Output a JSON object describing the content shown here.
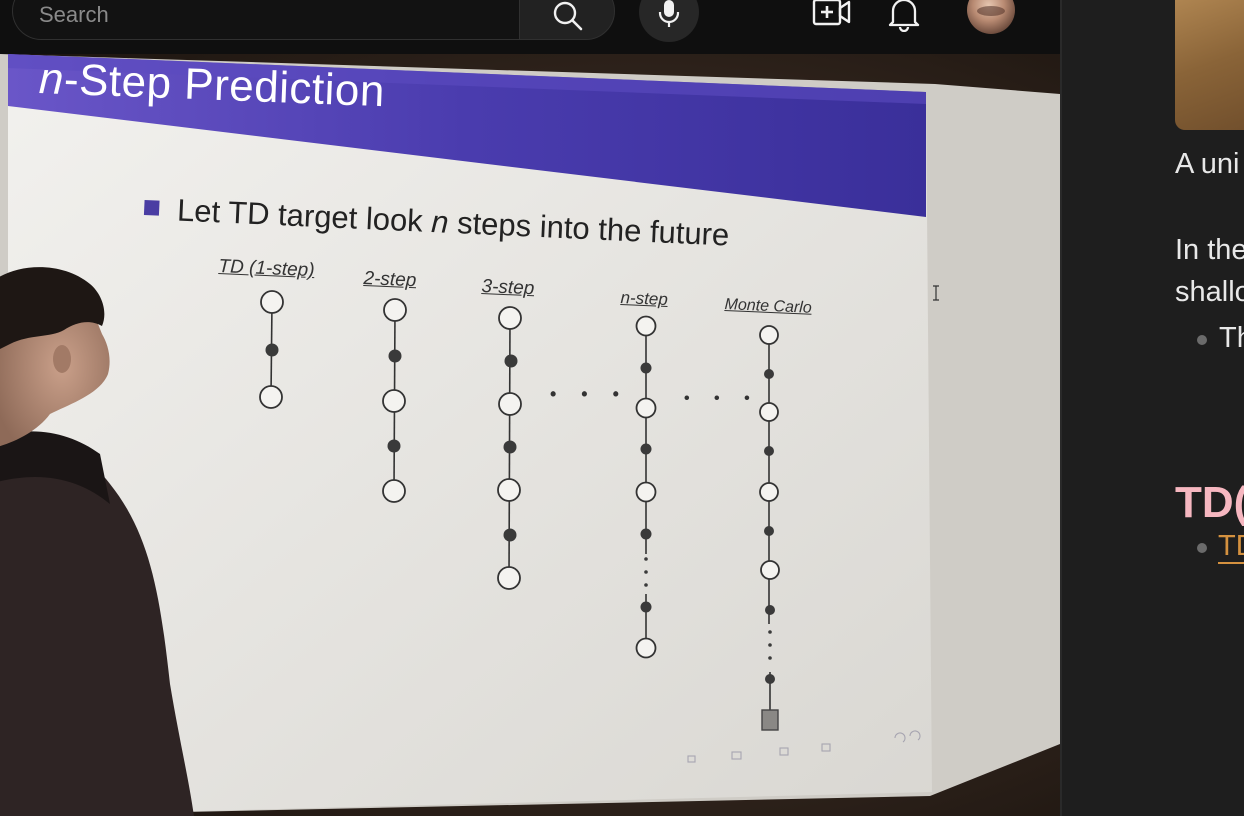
{
  "header": {
    "search_placeholder": "Search",
    "icons": [
      "search-icon",
      "microphone-icon",
      "create-video-icon",
      "notifications-bell-icon",
      "avatar"
    ]
  },
  "slide": {
    "title_n": "n",
    "title_rest": "-Step Prediction",
    "bullet_pre": "Let TD target look ",
    "bullet_n": "n",
    "bullet_post": " steps into the future",
    "columns": [
      "TD (1-step)",
      "2-step",
      "3-step",
      "n-step",
      "Monte Carlo"
    ],
    "ellipsis": "• • •",
    "colors": {
      "title_bar": "#4a3da3",
      "slide_bg": "#ececea"
    }
  },
  "side_panel": {
    "line1": "A uni",
    "line2": "In the",
    "line3": "shallo",
    "bullet1": "Th",
    "heading": "TD(",
    "link": "TD",
    "colors": {
      "heading": "#f6b7c0",
      "link": "#d4913f"
    }
  }
}
